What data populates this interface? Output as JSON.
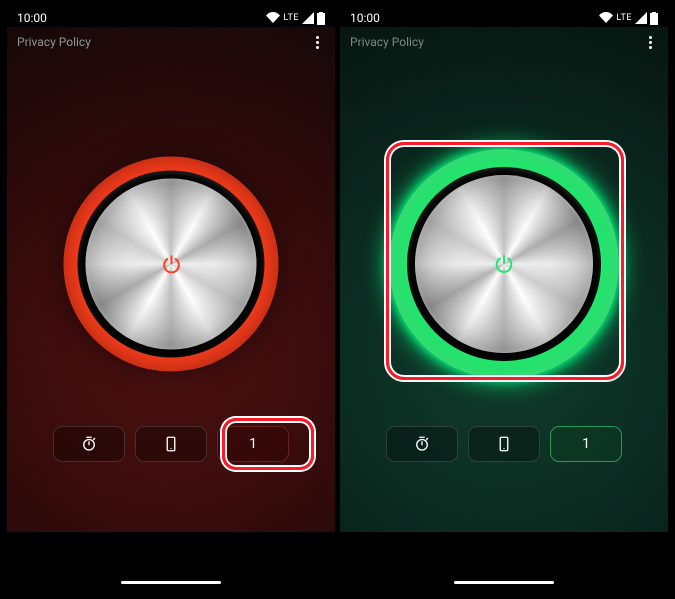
{
  "statusbar": {
    "time": "10:00",
    "network": "LTE"
  },
  "appbar": {
    "privacy": "Privacy Policy"
  },
  "controls": {
    "mode_value": "1"
  },
  "accent": {
    "red": "#ff3d24",
    "green": "#23e873"
  }
}
